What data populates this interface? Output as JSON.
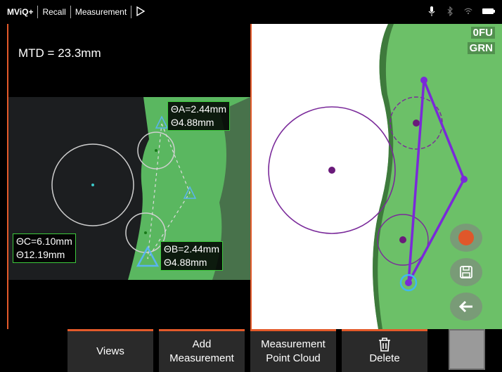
{
  "topbar": {
    "brand": "MViQ+",
    "crumbs": [
      "Recall",
      "Measurement"
    ],
    "icons": [
      "play-outline-icon",
      "microphone-icon",
      "bluetooth-icon",
      "wifi-icon",
      "battery-icon"
    ]
  },
  "left": {
    "mtd": "MTD = 23.3mm",
    "label_a": [
      "ΘA=2.44mm",
      "Θ4.88mm"
    ],
    "label_b": [
      "ΘB=2.44mm",
      "Θ4.88mm"
    ],
    "label_c": [
      "ΘC=6.10mm",
      "Θ12.19mm"
    ]
  },
  "right": {
    "badge_top": "0FU",
    "badge_bottom": "GRN",
    "side_buttons": [
      "record-icon",
      "save-icon",
      "back-arrow-icon"
    ]
  },
  "softkeys": {
    "views": "Views",
    "add_line1": "Add",
    "add_line2": "Measurement",
    "pc_line1": "Measurement",
    "pc_line2": "Point Cloud",
    "delete": "Delete"
  },
  "colors": {
    "accent": "#e45a2a",
    "measure_green": "#3cc83c",
    "purple": "#7a2a9a"
  }
}
